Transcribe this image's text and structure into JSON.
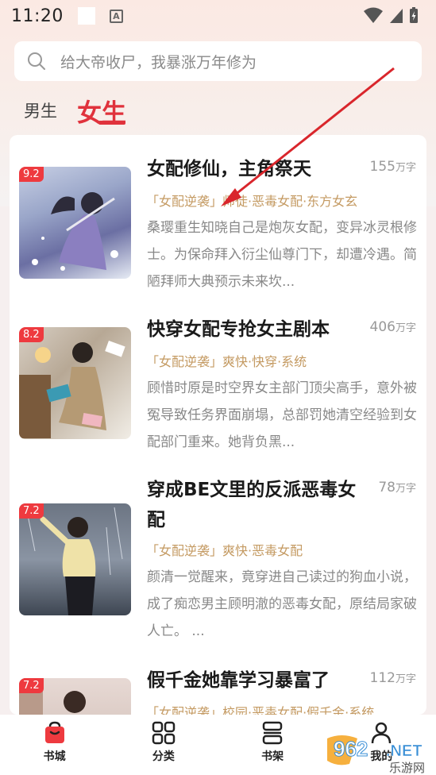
{
  "status_bar": {
    "time": "11:20",
    "badge_letter": "A"
  },
  "search": {
    "placeholder": "给大帝收尸，我暴涨万年修为"
  },
  "tabs": {
    "male": "男生",
    "female": "女生"
  },
  "books": [
    {
      "rating": "9.2",
      "title": "女配修仙，主角祭天",
      "count": "155",
      "unit": "万字",
      "tags": "「女配逆袭」师徒·恶毒女配·东方女玄",
      "desc": "桑璎重生知晓自己是炮灰女配，变异冰灵根修士。为保命拜入衍尘仙尊门下，却遭冷遇。简陋拜师大典预示未来坎..."
    },
    {
      "rating": "8.2",
      "title": "快穿女配专抢女主剧本",
      "count": "406",
      "unit": "万字",
      "tags": "「女配逆袭」爽快·快穿·系统",
      "desc": "顾惜时原是时空界女主部门顶尖高手，意外被冤导致任务界面崩塌，总部罚她清空经验到女配部门重来。她背负黑..."
    },
    {
      "rating": "7.2",
      "title": "穿成BE文里的反派恶毒女配",
      "count": "78",
      "unit": "万字",
      "tags": "「女配逆袭」爽快·恶毒女配",
      "desc": "颜清一觉醒来，竟穿进自己读过的狗血小说，成了痴恋男主顾明澈的恶毒女配，原结局家破人亡。 ..."
    },
    {
      "rating": "7.2",
      "title": "假千金她靠学习暴富了",
      "count": "112",
      "unit": "万字",
      "tags": "「女配逆袭」校园·恶毒女配·假千金·系统",
      "desc": ""
    }
  ],
  "nav": [
    {
      "label": "书城",
      "icon": "bag-icon"
    },
    {
      "label": "分类",
      "icon": "grid-icon"
    },
    {
      "label": "书架",
      "icon": "shelf-icon"
    },
    {
      "label": "我的",
      "icon": "person-icon"
    }
  ],
  "watermark": {
    "number": "962",
    "suffix": ".NET",
    "sub": "乐游网"
  },
  "colors": {
    "accent": "#e0323c",
    "tag": "#c49a62",
    "rating_bg": "#ee3a3f"
  }
}
